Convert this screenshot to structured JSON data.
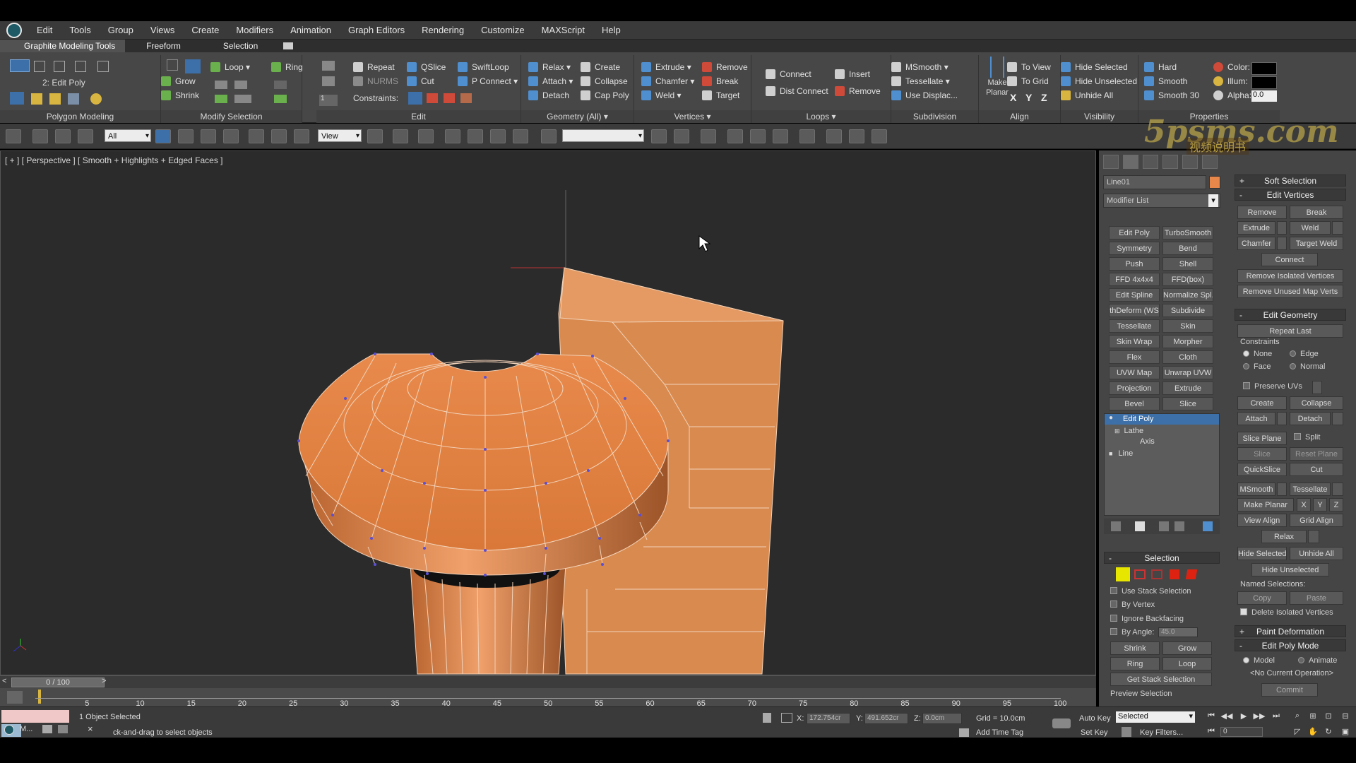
{
  "menu": {
    "items": [
      "Edit",
      "Tools",
      "Group",
      "Views",
      "Create",
      "Modifiers",
      "Animation",
      "Graph Editors",
      "Rendering",
      "Customize",
      "MAXScript",
      "Help"
    ]
  },
  "ribbon_tabs": {
    "title": "Graphite Modeling Tools",
    "tabs": [
      "Freeform",
      "Selection"
    ]
  },
  "ribbon": {
    "polygon_modeling": {
      "label": "Polygon Modeling",
      "level": "2: Edit Poly"
    },
    "modify_selection": {
      "label": "Modify Selection",
      "grow": "Grow",
      "shrink": "Shrink",
      "loop": "Loop",
      "ring": "Ring"
    },
    "edit": {
      "label": "Edit",
      "repeat": "Repeat",
      "qslice": "QSlice",
      "swiftloop": "SwiftLoop",
      "nurms": "NURMS",
      "cut": "Cut",
      "pconnect": "P Connect",
      "constraints": "Constraints:"
    },
    "geometry": {
      "label": "Geometry (All)",
      "relax": "Relax",
      "create": "Create",
      "attach": "Attach",
      "collapse": "Collapse",
      "detach": "Detach",
      "cap_poly": "Cap Poly"
    },
    "vertices": {
      "label": "Vertices",
      "extrude": "Extrude",
      "remove": "Remove",
      "chamfer": "Chamfer",
      "break": "Break",
      "weld": "Weld",
      "target": "Target"
    },
    "loops": {
      "label": "Loops",
      "connect": "Connect",
      "insert": "Insert",
      "dist_connect": "Dist Connect",
      "remove": "Remove"
    },
    "subdivision": {
      "label": "Subdivision",
      "msmooth": "MSmooth",
      "tessellate": "Tessellate",
      "use_displac": "Use Displac..."
    },
    "align": {
      "label": "Align",
      "make_planar": "Make\nPlanar",
      "to_view": "To View",
      "to_grid": "To Grid",
      "x": "X",
      "y": "Y",
      "z": "Z"
    },
    "visibility": {
      "label": "Visibility",
      "hide_selected": "Hide Selected",
      "hide_unselected": "Hide Unselected",
      "unhide_all": "Unhide All"
    },
    "properties": {
      "label": "Properties",
      "hard": "Hard",
      "smooth": "Smooth",
      "smooth30": "Smooth 30",
      "color": "Color:",
      "illum": "Illum:",
      "alpha": "Alpha:",
      "alpha_value": "0.0"
    }
  },
  "toolbar": {
    "filter": "All",
    "ref_coord": "View"
  },
  "viewport": {
    "label": "[ + ] [ Perspective ] [ Smooth + Highlights + Edged Faces ]"
  },
  "command_panel": {
    "object_name": "Line01",
    "object_color": "#e8874a",
    "modifier_list": "Modifier List",
    "modifier_buttons": [
      [
        "Edit Poly",
        "TurboSmooth"
      ],
      [
        "Symmetry",
        "Bend"
      ],
      [
        "Push",
        "Shell"
      ],
      [
        "FFD 4x4x4",
        "FFD(box)"
      ],
      [
        "Edit Spline",
        "Normalize Spl."
      ],
      [
        "thDeform (WS",
        "Subdivide"
      ],
      [
        "Tessellate",
        "Skin"
      ],
      [
        "Skin Wrap",
        "Morpher"
      ],
      [
        "Flex",
        "Cloth"
      ],
      [
        "UVW Map",
        "Unwrap UVW"
      ],
      [
        "Projection",
        "Extrude"
      ],
      [
        "Bevel",
        "Slice"
      ]
    ],
    "stack": [
      "Edit Poly",
      "Lathe",
      "Axis",
      "Line"
    ],
    "selection": {
      "title": "Selection",
      "use_stack": "Use Stack Selection",
      "by_vertex": "By Vertex",
      "ignore_backfacing": "Ignore Backfacing",
      "by_angle": "By Angle:",
      "by_angle_value": "45.0",
      "shrink": "Shrink",
      "grow": "Grow",
      "ring": "Ring",
      "loop": "Loop",
      "get_stack": "Get Stack Selection",
      "preview": "Preview Selection"
    },
    "soft_selection": "Soft Selection",
    "edit_vertices": {
      "title": "Edit Vertices",
      "remove": "Remove",
      "break": "Break",
      "extrude": "Extrude",
      "weld": "Weld",
      "chamfer": "Chamfer",
      "target_weld": "Target Weld",
      "connect": "Connect",
      "remove_isolated": "Remove Isolated Vertices",
      "remove_unused": "Remove Unused Map Verts"
    },
    "edit_geometry": {
      "title": "Edit Geometry",
      "repeat_last": "Repeat Last",
      "constraints": "Constraints",
      "none": "None",
      "edge": "Edge",
      "face": "Face",
      "normal": "Normal",
      "preserve_uvs": "Preserve UVs",
      "create": "Create",
      "collapse": "Collapse",
      "attach": "Attach",
      "detach": "Detach",
      "slice_plane": "Slice Plane",
      "split": "Split",
      "slice": "Slice",
      "reset_plane": "Reset Plane",
      "quickslice": "QuickSlice",
      "cut": "Cut",
      "msmooth": "MSmooth",
      "tessellate": "Tessellate",
      "make_planar": "Make Planar",
      "x": "X",
      "y": "Y",
      "z": "Z",
      "view_align": "View Align",
      "grid_align": "Grid Align",
      "relax": "Relax",
      "hide_selected": "Hide Selected",
      "unhide_all": "Unhide All",
      "hide_unselected": "Hide Unselected",
      "named_selections": "Named Selections:",
      "copy": "Copy",
      "paste": "Paste",
      "delete_isolated": "Delete Isolated Vertices"
    },
    "paint_deformation": "Paint Deformation",
    "edit_poly_mode": {
      "title": "Edit Poly Mode",
      "model": "Model",
      "animate": "Animate",
      "no_op": "<No Current Operation>",
      "commit": "Commit"
    }
  },
  "timeline": {
    "frame": "0 / 100",
    "ticks": [
      "5",
      "10",
      "15",
      "20",
      "25",
      "30",
      "35",
      "40",
      "45",
      "50",
      "55",
      "60",
      "65",
      "70",
      "75",
      "80",
      "85",
      "90",
      "95",
      "100"
    ]
  },
  "status": {
    "selected": "1 Object Selected",
    "prompt": "ck-and-drag to select objects",
    "x_label": "X:",
    "x_value": "172.754cr",
    "y_label": "Y:",
    "y_value": "491.652cr",
    "z_label": "Z:",
    "z_value": "0.0cm",
    "grid": "Grid = 10.0cm",
    "add_time_tag": "Add Time Tag",
    "auto_key": "Auto Key",
    "set_key": "Set Key",
    "key_mode": "Selected",
    "key_filters": "Key Filters...",
    "frame_field": "0"
  },
  "taskbar": {
    "app": "M..."
  },
  "watermark": {
    "text": "5psms.com",
    "sub": "视频说明书"
  }
}
